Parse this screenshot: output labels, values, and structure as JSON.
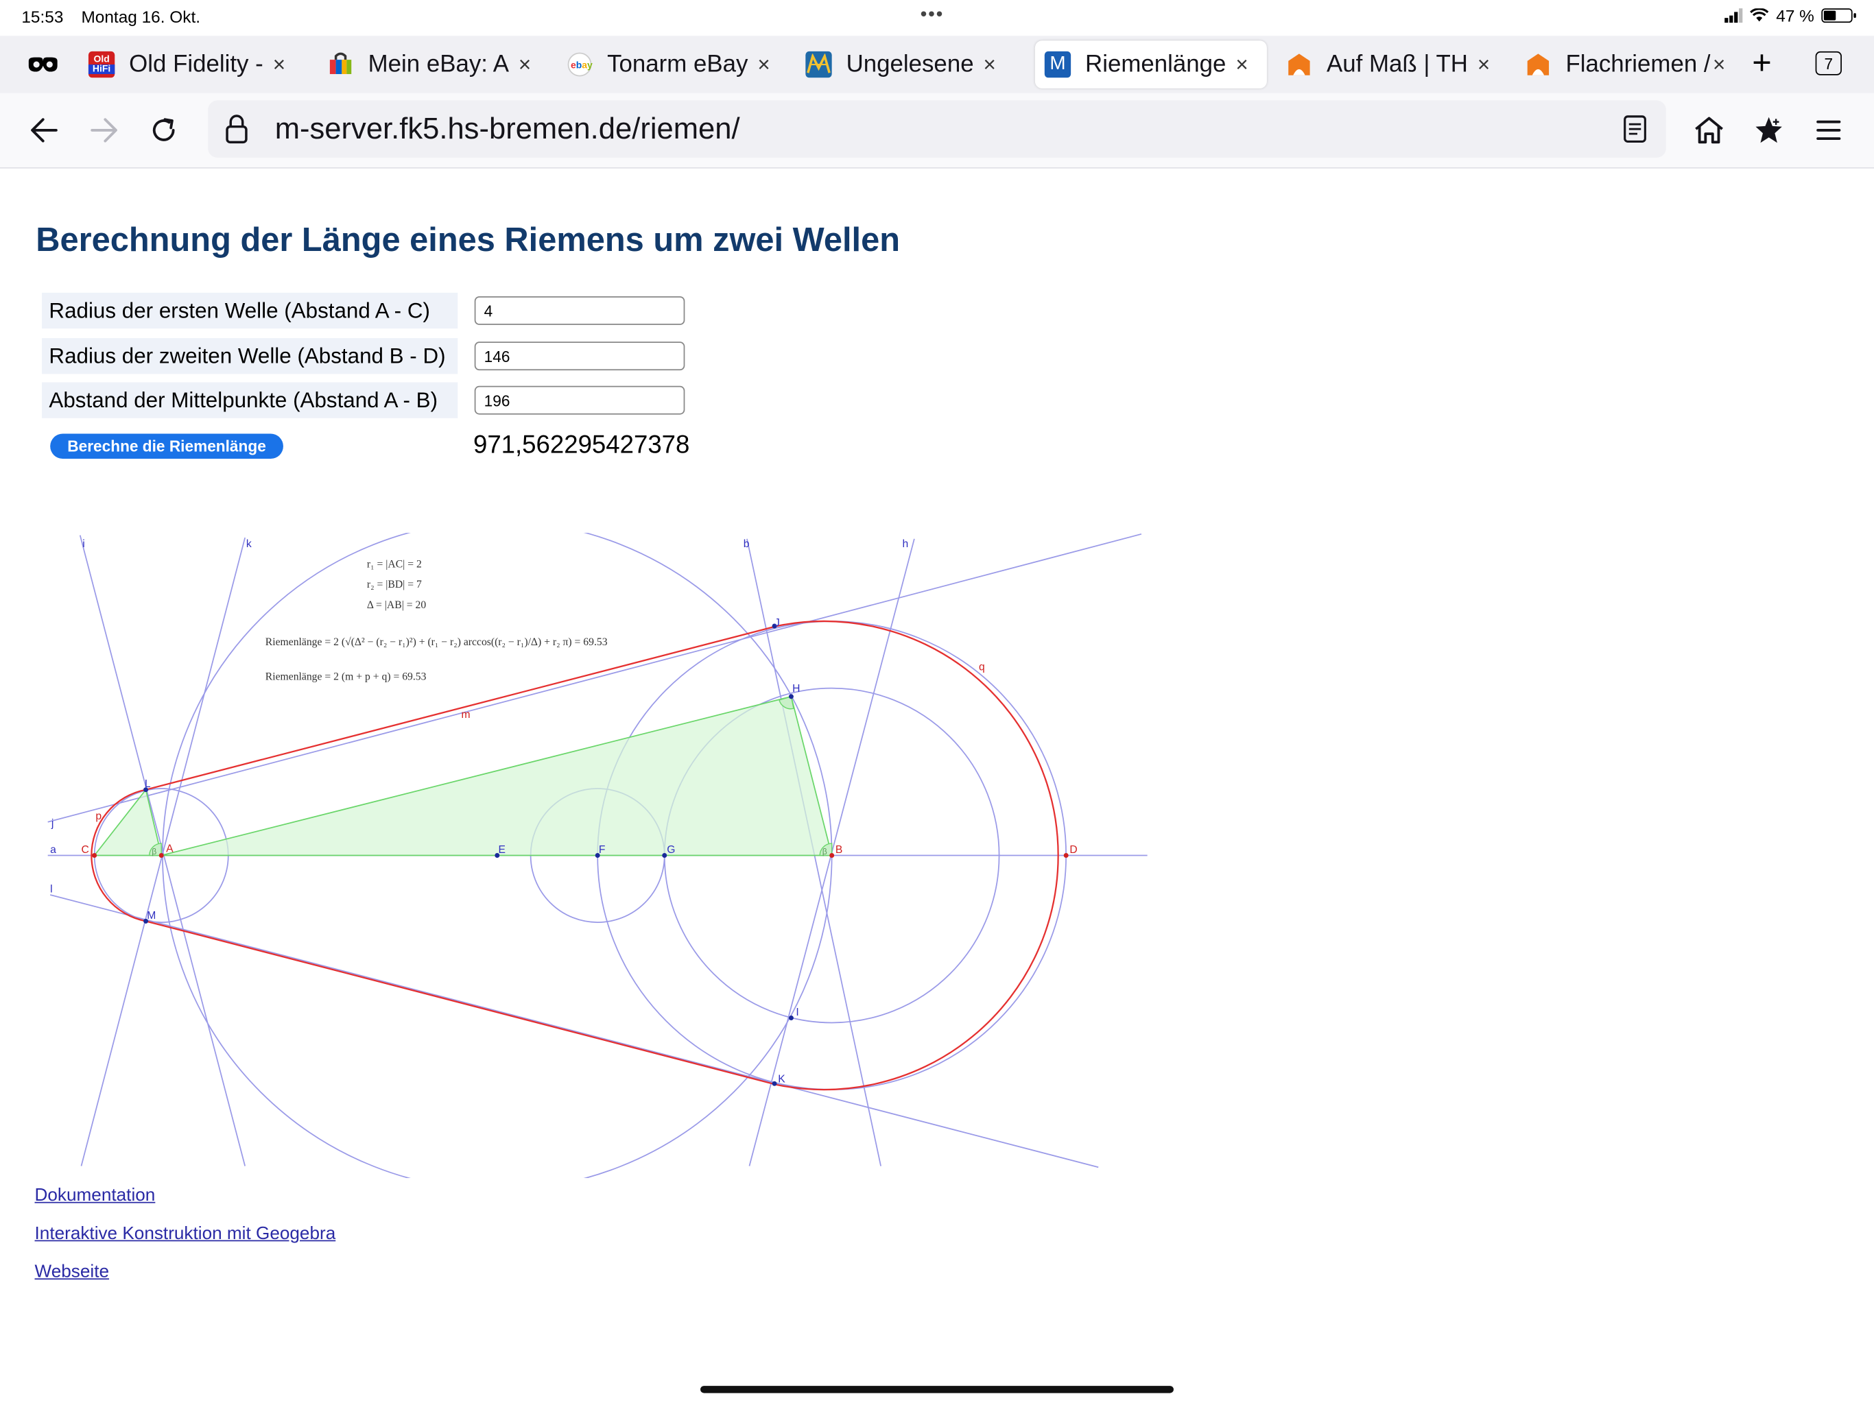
{
  "status_bar": {
    "time": "15:53",
    "date": "Montag 16. Okt.",
    "battery": "47 %",
    "battery_level": 0.47
  },
  "tabs": [
    {
      "label": "Old Fidelity -",
      "favicon": "oldhifi-favicon",
      "active": false
    },
    {
      "label": "Mein eBay: A",
      "favicon": "ebay-bag-favicon",
      "active": false
    },
    {
      "label": "Tonarm eBay",
      "favicon": "ebay-favicon",
      "active": false
    },
    {
      "label": "Ungelesene",
      "favicon": "mail-favicon",
      "active": false
    },
    {
      "label": "Riemenlänge",
      "favicon": "m-favicon",
      "active": true
    },
    {
      "label": "Auf Maß | TH",
      "favicon": "orange-favicon",
      "active": false
    },
    {
      "label": "Flachriemen /",
      "favicon": "orange-favicon",
      "active": false
    }
  ],
  "tab_count": "7",
  "favicon_text": {
    "oldhifi_top": "Old",
    "oldhifi_bottom": "HiFi",
    "m": "M"
  },
  "navbar": {
    "url": "m-server.fk5.hs-bremen.de/riemen/"
  },
  "page": {
    "title": "Berechnung der Länge eines Riemens um zwei Wellen",
    "fields": [
      {
        "label": "Radius der ersten Welle (Abstand A - C)",
        "value": "4"
      },
      {
        "label": "Radius der zweiten Welle (Abstand B - D)",
        "value": "146"
      },
      {
        "label": "Abstand der Mittelpunkte (Abstand A - B)",
        "value": "196"
      }
    ],
    "button_label": "Berechne die Riemenlänge",
    "result": "971,562295427378",
    "links": [
      "Dokumentation",
      "Interaktive Konstruktion mit Geogebra",
      "Webseite"
    ]
  },
  "diagram": {
    "formula_r1": "r₁ = |AC| = 2",
    "formula_r2": "r₂ = |BD| = 7",
    "formula_delta": "Δ = |AB| = 20",
    "formula_riemen1": "Riemenlänge = 2 (√(Δ² − (r₂ − r₁)²) + (r₁ − r₂) arccos((r₂ − r₁)/Δ) + r₂ π) = 69.53",
    "formula_riemen2": "Riemenlänge = 2 (m + p + q) = 69.53",
    "point_labels": {
      "A": "A",
      "B": "B",
      "C": "C",
      "D": "D",
      "E": "E",
      "F": "F",
      "G": "G",
      "H": "H",
      "I": "I",
      "J": "J",
      "K": "K",
      "L": "L",
      "M": "M"
    },
    "line_labels": {
      "i": "i",
      "k": "k",
      "b": "b",
      "h": "h",
      "j": "j",
      "a": "a",
      "l": "l",
      "m": "m",
      "p": "p",
      "q": "q"
    },
    "angle_label": "β",
    "colors": {
      "construction": "#9a9ae8",
      "belt": "#e53030",
      "triangle_fill": "#d6f7d6",
      "triangle_stroke": "#6ad66a",
      "point": "#1a2a9a",
      "label": "#3030c0"
    }
  }
}
